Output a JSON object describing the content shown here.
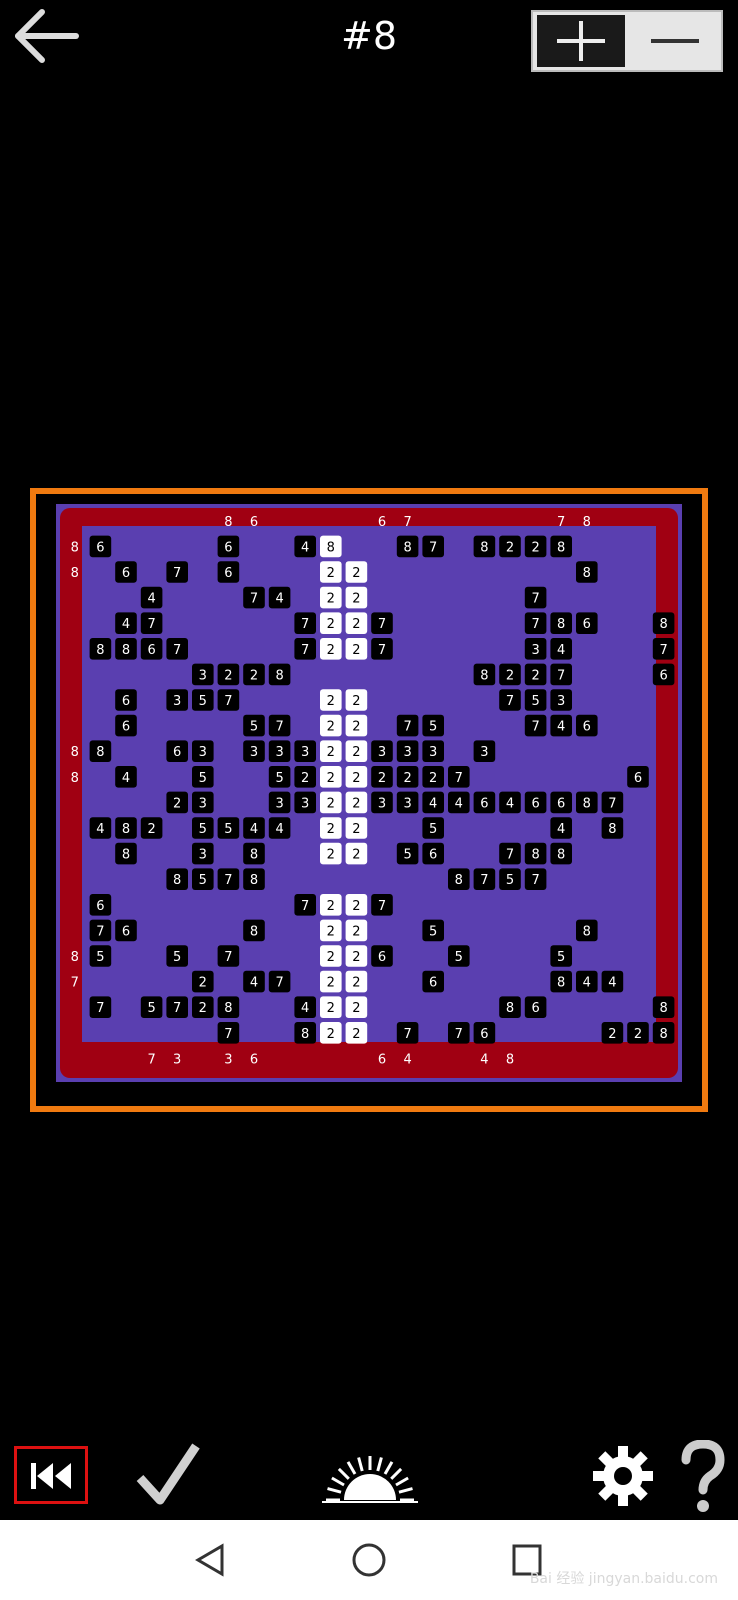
{
  "header": {
    "title": "#8",
    "back_icon": "arrow-left-icon",
    "zoom_in_icon": "plus-icon",
    "zoom_out_icon": "minus-icon"
  },
  "colors": {
    "background": "#000000",
    "frame": "#f07a10",
    "outer_ring": "#a00012",
    "wall": "#5a3fb0",
    "path": "#000000",
    "filled_path": "#ffffff",
    "grey_cell": "#a9a9a9"
  },
  "board": {
    "rows": [
      [
        "",
        "",
        "",
        "",
        "",
        "",
        "8",
        "6",
        "",
        "",
        "",
        "",
        "6",
        "7",
        "",
        "",
        "",
        "",
        "",
        "7",
        "8",
        "",
        "",
        "",
        ""
      ],
      [
        "8",
        "6",
        "",
        "",
        "",
        "",
        "6",
        "",
        "",
        "4",
        "8",
        "",
        "",
        "8",
        "7",
        "",
        "8",
        "2",
        "2",
        "8",
        "",
        "",
        "",
        "",
        ""
      ],
      [
        "8",
        "",
        "6",
        "",
        "7",
        "",
        "6",
        "",
        "",
        "",
        "2",
        "2",
        "",
        "",
        "",
        "",
        "",
        "",
        "",
        "",
        "8",
        "",
        "",
        "",
        ""
      ],
      [
        "",
        "",
        "",
        "4",
        "",
        "",
        "",
        "7",
        "4",
        "",
        "2",
        "2",
        "",
        "",
        "",
        "",
        "",
        "",
        "7",
        "",
        "",
        "",
        "",
        "",
        ""
      ],
      [
        "",
        "",
        "4",
        "7",
        "",
        "",
        "",
        "",
        "",
        "7",
        "2",
        "2",
        "7",
        "",
        "",
        "",
        "",
        "",
        "7",
        "8",
        "6",
        "",
        "",
        "8",
        ""
      ],
      [
        "",
        "8",
        "8",
        "6",
        "7",
        "",
        "",
        "",
        "",
        "7",
        "2",
        "2",
        "7",
        "",
        "",
        "",
        "",
        "",
        "3",
        "4",
        "",
        "",
        "",
        "7",
        ""
      ],
      [
        "",
        "",
        "",
        "",
        "",
        "3",
        "2",
        "2",
        "8",
        "",
        "",
        "",
        "",
        "",
        "",
        "",
        "8",
        "2",
        "2",
        "7",
        "",
        "",
        "",
        "6",
        ""
      ],
      [
        "",
        "",
        "6",
        "",
        "3",
        "5",
        "7",
        "",
        "",
        "",
        "2",
        "2",
        "",
        "",
        "",
        "",
        "",
        "7",
        "5",
        "3",
        "",
        "",
        "",
        "",
        ""
      ],
      [
        "",
        "",
        "6",
        "",
        "",
        "",
        "",
        "5",
        "7",
        "",
        "2",
        "2",
        "",
        "7",
        "5",
        "",
        "",
        "",
        "7",
        "4",
        "6",
        "",
        "",
        "",
        ""
      ],
      [
        "8",
        "8",
        "",
        "",
        "6",
        "3",
        "",
        "3",
        "3",
        "3",
        "2",
        "2",
        "3",
        "3",
        "3",
        "",
        "3",
        "",
        "",
        "",
        "",
        "",
        "",
        "",
        ""
      ],
      [
        "8",
        "",
        "4",
        "",
        "",
        "5",
        "",
        "",
        "5",
        "2",
        "2",
        "2",
        "2",
        "2",
        "2",
        "7",
        "",
        "",
        "",
        "",
        "",
        "",
        "6",
        "",
        ""
      ],
      [
        "",
        "",
        "",
        "",
        "2",
        "3",
        "",
        "",
        "3",
        "3",
        "2",
        "2",
        "3",
        "3",
        "4",
        "4",
        "6",
        "4",
        "6",
        "6",
        "8",
        "7",
        "",
        "",
        ""
      ],
      [
        "",
        "4",
        "8",
        "2",
        "",
        "5",
        "5",
        "4",
        "4",
        "",
        "2",
        "2",
        "",
        "",
        "5",
        "",
        "",
        "",
        "",
        "4",
        "",
        "8",
        "",
        "",
        ""
      ],
      [
        "",
        "",
        "8",
        "",
        "",
        "3",
        "",
        "8",
        "",
        "",
        "2",
        "2",
        "",
        "5",
        "6",
        "",
        "",
        "7",
        "8",
        "8",
        "",
        "",
        "",
        "",
        ""
      ],
      [
        "",
        "",
        "",
        "",
        "8",
        "5",
        "7",
        "8",
        "",
        "",
        "",
        "",
        "",
        "",
        "",
        "8",
        "7",
        "5",
        "7",
        "",
        "",
        "",
        "",
        "",
        ""
      ],
      [
        "",
        "6",
        "",
        "",
        "",
        "",
        "",
        "",
        "",
        "7",
        "2",
        "2",
        "7",
        "",
        "",
        "",
        "",
        "",
        "",
        "",
        "",
        "",
        "",
        "",
        ""
      ],
      [
        "",
        "7",
        "6",
        "",
        "",
        "",
        "",
        "8",
        "",
        "",
        "2",
        "2",
        "",
        "",
        "5",
        "",
        "",
        "",
        "",
        "",
        "8",
        "",
        "",
        "",
        ""
      ],
      [
        "8",
        "5",
        "",
        "",
        "5",
        "",
        "7",
        "",
        "",
        "",
        "2",
        "2",
        "6",
        "",
        "",
        "5",
        "",
        "",
        "",
        "5",
        "",
        "",
        "",
        "",
        ""
      ],
      [
        "7",
        "",
        "",
        "",
        "",
        "2",
        "",
        "4",
        "7",
        "",
        "2",
        "2",
        "",
        "",
        "6",
        "",
        "",
        "",
        "",
        "8",
        "4",
        "4",
        "",
        "",
        ""
      ],
      [
        "",
        "7",
        "",
        "5",
        "7",
        "2",
        "8",
        "",
        "",
        "4",
        "2",
        "2",
        "",
        "",
        "",
        "",
        "",
        "8",
        "6",
        "",
        "",
        "",
        "",
        "8",
        ""
      ],
      [
        "",
        "",
        "",
        "",
        "",
        "",
        "7",
        "",
        "",
        "8",
        "2",
        "2",
        "",
        "7",
        "",
        "7",
        "6",
        "",
        "",
        "",
        "",
        "2",
        "2",
        "8",
        ""
      ],
      [
        "",
        "",
        "",
        "7",
        "3",
        "",
        "3",
        "6",
        "",
        "",
        "",
        "",
        "6",
        "4",
        "",
        "",
        "4",
        "8",
        "",
        "",
        "",
        "",
        "",
        "",
        ""
      ]
    ]
  },
  "toolbar": {
    "undo_icon": "rewind-icon",
    "check_icon": "checkmark-icon",
    "hint_icon": "sunrise-icon",
    "settings_icon": "gear-icon",
    "help_icon": "question-mark-icon"
  },
  "navbar": {
    "back_icon": "triangle-back-icon",
    "home_icon": "circle-home-icon",
    "recents_icon": "square-recents-icon",
    "watermark": "Bai 经验 jingyan.baidu.com"
  }
}
